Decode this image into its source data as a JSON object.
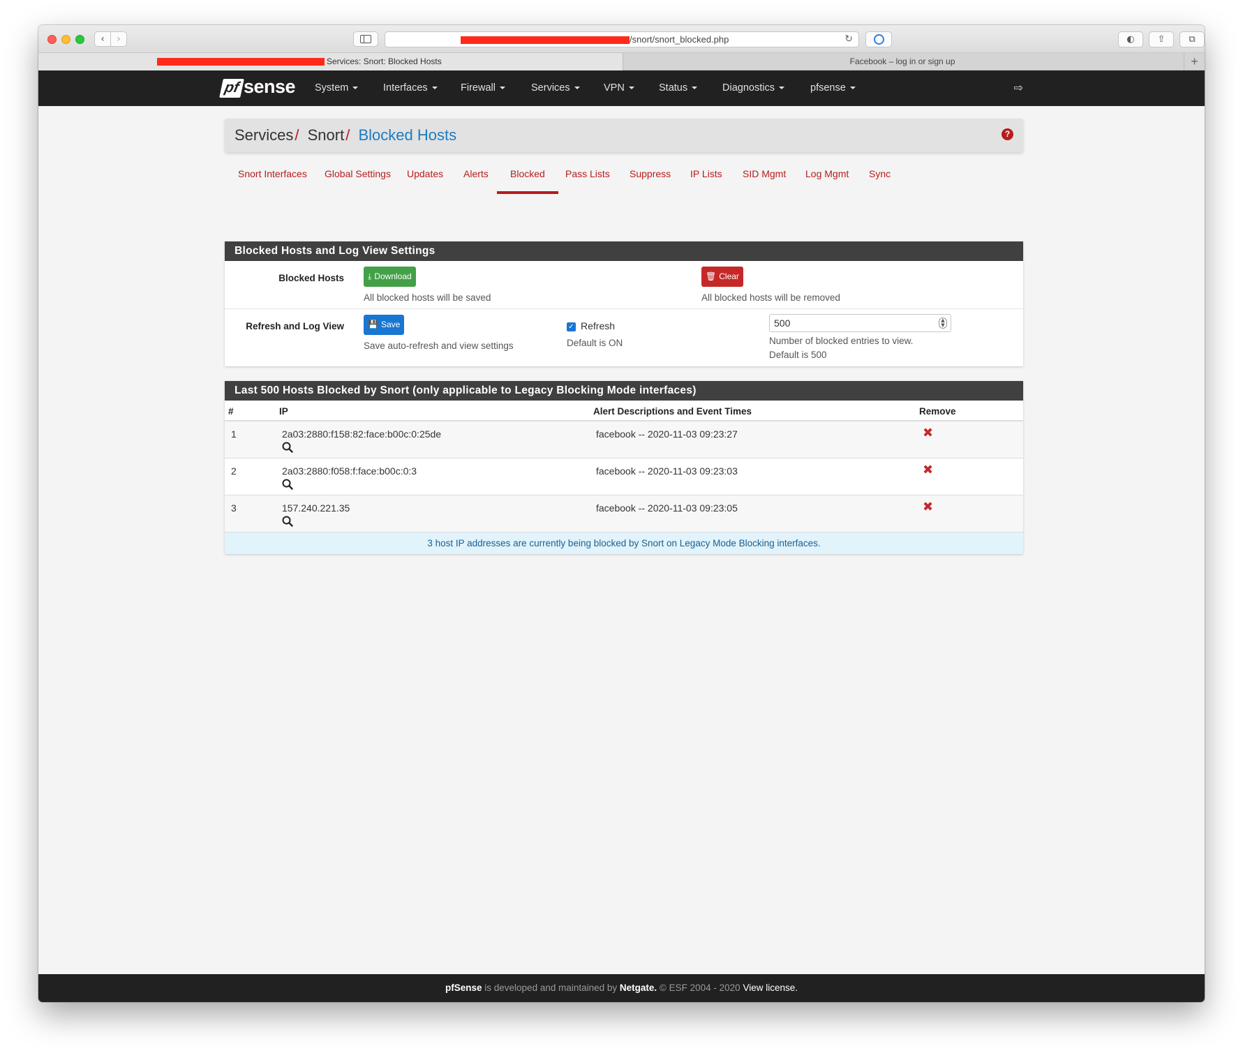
{
  "browser": {
    "url": "/snort/snort_blocked.php",
    "tabs": [
      {
        "title": "Services: Snort: Blocked Hosts",
        "active": true
      },
      {
        "title": "Facebook – log in or sign up",
        "active": false
      }
    ],
    "new_tab": "+"
  },
  "nav": {
    "logo_pf": "pf",
    "logo_sense": "sense",
    "menu": [
      "System",
      "Interfaces",
      "Firewall",
      "Services",
      "VPN",
      "Status",
      "Diagnostics",
      "pfsense"
    ]
  },
  "breadcrumb": {
    "items": [
      "Services",
      "Snort"
    ],
    "sep": "/",
    "active": "Blocked Hosts"
  },
  "tabs": [
    {
      "label": "Snort Interfaces",
      "active": false
    },
    {
      "label": "Global Settings",
      "active": false
    },
    {
      "label": "Updates",
      "active": false
    },
    {
      "label": "Alerts",
      "active": false
    },
    {
      "label": "Blocked",
      "active": true
    },
    {
      "label": "Pass Lists",
      "active": false
    },
    {
      "label": "Suppress",
      "active": false
    },
    {
      "label": "IP Lists",
      "active": false
    },
    {
      "label": "SID Mgmt",
      "active": false
    },
    {
      "label": "Log Mgmt",
      "active": false
    },
    {
      "label": "Sync",
      "active": false
    }
  ],
  "settings": {
    "title": "Blocked Hosts and Log View Settings",
    "blocked_label": "Blocked Hosts",
    "download_label": "Download",
    "download_help": "All blocked hosts will be saved",
    "clear_label": "Clear",
    "clear_help": "All blocked hosts will be removed",
    "refresh_row_label": "Refresh and Log View",
    "save_label": "Save",
    "save_help": "Save auto-refresh and view settings",
    "refresh_label": "Refresh",
    "refresh_checked": true,
    "refresh_help": "Default is ON",
    "entries_value": "500",
    "entries_help_1": "Number of blocked entries to view.",
    "entries_help_2": "Default is 500"
  },
  "blocked": {
    "title": "Last 500 Hosts Blocked by Snort (only applicable to Legacy Blocking Mode interfaces)",
    "columns": [
      "#",
      "IP",
      "Alert Descriptions and Event Times",
      "Remove"
    ],
    "rows": [
      {
        "num": "1",
        "ip": "2a03:2880:f158:82:face:b00c:0:25de",
        "desc": "facebook -- 2020-11-03 09:23:27"
      },
      {
        "num": "2",
        "ip": "2a03:2880:f058:f:face:b00c:0:3",
        "desc": "facebook -- 2020-11-03 09:23:03"
      },
      {
        "num": "3",
        "ip": "157.240.221.35",
        "desc": "facebook -- 2020-11-03 09:23:05"
      }
    ],
    "info": "3 host IP addresses are currently being blocked by Snort on Legacy Mode Blocking interfaces."
  },
  "footer": {
    "brand": "pfSense",
    "text1": " is developed and maintained by ",
    "company": "Netgate.",
    "text2": " © ESF 2004 - 2020 ",
    "license": "View license."
  },
  "colors": {
    "accent_red": "#b71c1c",
    "link_blue": "#1e7bc3",
    "nav_bg": "#212121",
    "panel_head": "#404040"
  }
}
